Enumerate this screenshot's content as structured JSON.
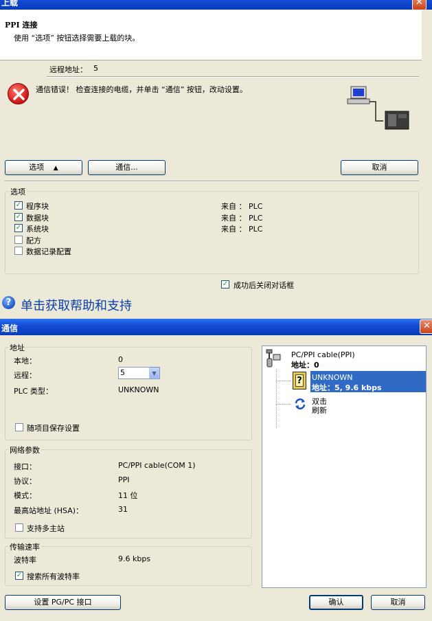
{
  "upload_dialog": {
    "title": "上载",
    "header_title": "PPI 连接",
    "header_desc": "使用 “选项” 按钮选择需要上载的块。",
    "remote_address_label": "远程地址：",
    "remote_address_value": "5",
    "error_message": "通信错误！ 检查连接的电缆，并单击 “通信” 按钮，改动设置。",
    "options_button": "选项",
    "comm_button": "通信...",
    "cancel_button": "取消",
    "options_group_title": "选项",
    "options": [
      {
        "label": "程序块",
        "checked": true,
        "source": "来自 ： PLC"
      },
      {
        "label": "数据块",
        "checked": true,
        "source": "来自 ： PLC"
      },
      {
        "label": "系统块",
        "checked": true,
        "source": "来自 ： PLC"
      },
      {
        "label": "配方",
        "checked": false,
        "source": ""
      },
      {
        "label": "数据记录配置",
        "checked": false,
        "source": ""
      }
    ],
    "close_on_success_label": "成功后关闭对话框",
    "close_on_success_checked": true,
    "help_link": "单击获取帮助和支持"
  },
  "comm_dialog": {
    "title": "通信",
    "address_group": "地址",
    "local_label": "本地：",
    "local_value": "0",
    "remote_label": "远程：",
    "remote_value": "5",
    "plc_type_label": "PLC 类型：",
    "plc_type_value": "UNKNOWN",
    "save_with_project_label": "随项目保存设置",
    "network_group": "网络参数",
    "interface_label": "接口：",
    "interface_value": "PC/PPI cable(COM 1)",
    "protocol_label": "协议：",
    "protocol_value": "PPI",
    "mode_label": "模式：",
    "mode_value": "11 位",
    "hsa_label": "最高站地址 (HSA)：",
    "hsa_value": "31",
    "multi_master_label": "支持多主站",
    "baud_group": "传输速率",
    "baud_label": "波特率",
    "baud_value": "9.6 kbps",
    "search_all_label": "搜索所有波特率",
    "tree": {
      "cable_name": "PC/PPI cable(PPI)",
      "cable_addr": "地址：0",
      "device_name": "UNKNOWN",
      "device_addr": "地址：5, 9.6 kbps",
      "refresh_line1": "双击",
      "refresh_line2": "刷新"
    },
    "setup_button": "设置 PG/PC 接口",
    "ok_button": "确认",
    "cancel_button": "取消"
  },
  "colors": {
    "titlebar": "#0a3fc2",
    "dialog_bg": "#ece9d8",
    "selection": "#316ac5",
    "help_link": "#0b3fa8",
    "error_red": "#d42020"
  }
}
